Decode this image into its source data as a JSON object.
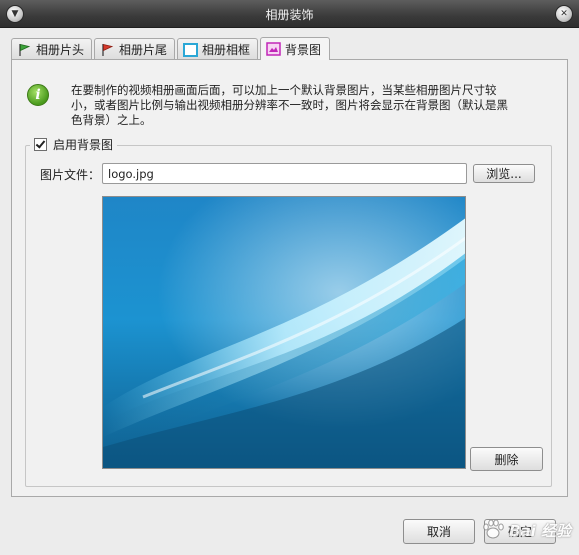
{
  "window": {
    "title": "相册装饰"
  },
  "tabs": [
    {
      "label": "相册片头",
      "icon": "green-flag-icon",
      "active": false
    },
    {
      "label": "相册片尾",
      "icon": "red-flag-icon",
      "active": false
    },
    {
      "label": "相册相框",
      "icon": "frame-icon",
      "active": false
    },
    {
      "label": "背景图",
      "icon": "image-icon",
      "active": true
    }
  ],
  "info": {
    "icon": "info-icon",
    "text": "在要制作的视频相册画面后面，可以加上一个默认背景图片，当某些相册图片尺寸较小，或者图片比例与输出视频相册分辨率不一致时，图片将会显示在背景图（默认是黑色背景）之上。"
  },
  "background": {
    "enable_label": "启用背景图",
    "enabled": true,
    "file_label": "图片文件：",
    "file_value": "logo.jpg",
    "browse_label": "浏览...",
    "delete_label": "删除"
  },
  "footer": {
    "cancel_label": "取消",
    "ok_label": "确定"
  },
  "watermark": {
    "text": "Bai 经验",
    "domain": "jingyan.baidu.com"
  },
  "colors": {
    "titlebar": "#3a3a3a",
    "panel_bg": "#f1f1f1",
    "preview_blue": "#1a8cc9",
    "info_green": "#4a9a1d"
  }
}
